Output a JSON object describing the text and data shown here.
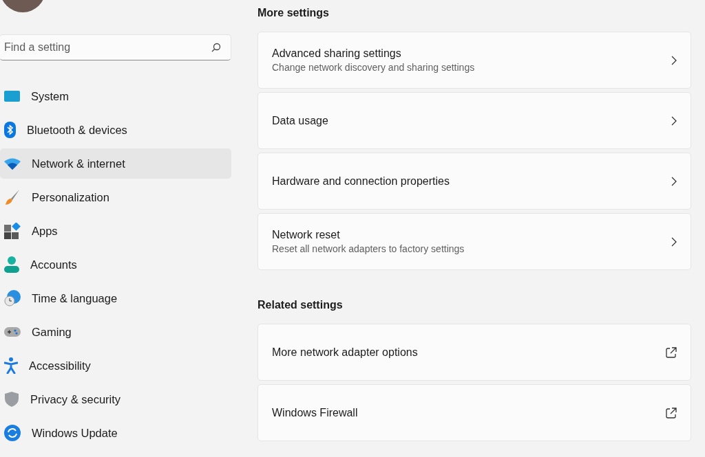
{
  "search": {
    "placeholder": "Find a setting"
  },
  "nav": [
    {
      "label": "System",
      "selected": false
    },
    {
      "label": "Bluetooth & devices",
      "selected": false
    },
    {
      "label": "Network & internet",
      "selected": true
    },
    {
      "label": "Personalization",
      "selected": false
    },
    {
      "label": "Apps",
      "selected": false
    },
    {
      "label": "Accounts",
      "selected": false
    },
    {
      "label": "Time & language",
      "selected": false
    },
    {
      "label": "Gaming",
      "selected": false
    },
    {
      "label": "Accessibility",
      "selected": false
    },
    {
      "label": "Privacy & security",
      "selected": false
    },
    {
      "label": "Windows Update",
      "selected": false
    }
  ],
  "sections": [
    {
      "title": "More settings",
      "cards": [
        {
          "title": "Advanced sharing settings",
          "subtitle": "Change network discovery and sharing settings",
          "kind": "navigate"
        },
        {
          "title": "Data usage",
          "kind": "navigate"
        },
        {
          "title": "Hardware and connection properties",
          "kind": "navigate"
        },
        {
          "title": "Network reset",
          "subtitle": "Reset all network adapters to factory settings",
          "kind": "navigate"
        }
      ]
    },
    {
      "title": "Related settings",
      "cards": [
        {
          "title": "More network adapter options",
          "kind": "external"
        },
        {
          "title": "Windows Firewall",
          "kind": "external"
        }
      ]
    }
  ]
}
